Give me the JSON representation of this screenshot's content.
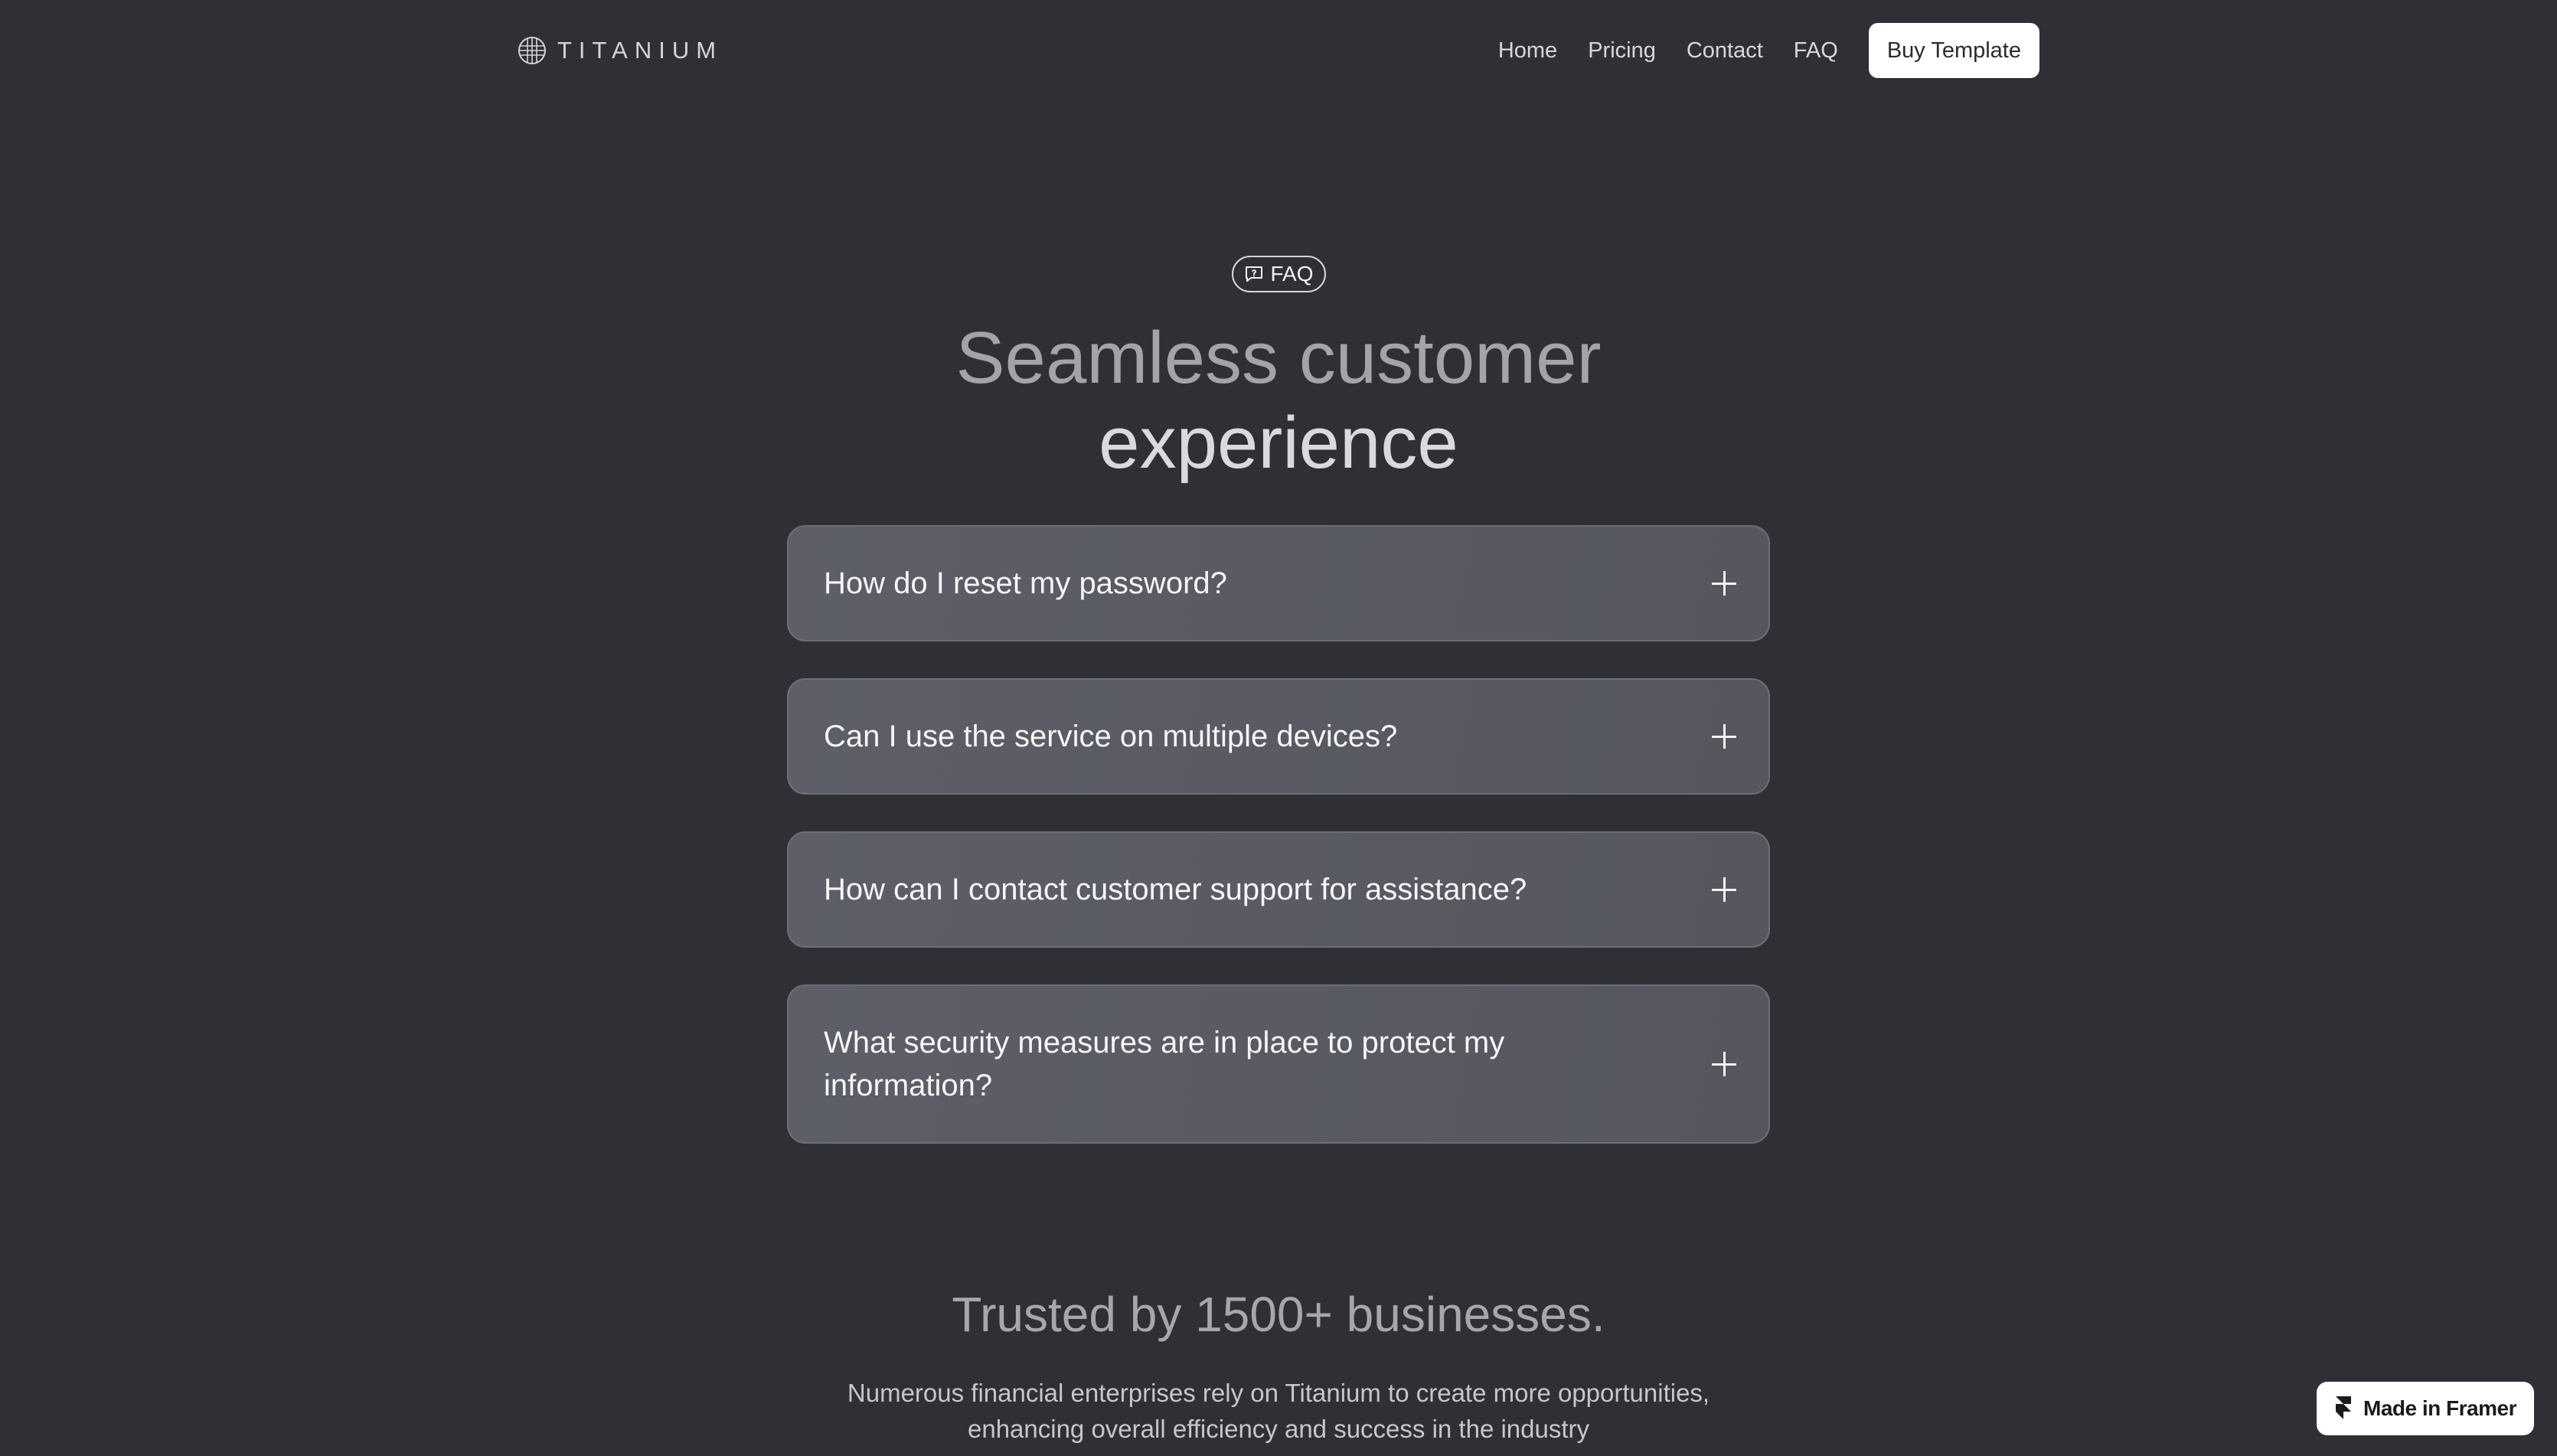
{
  "nav": {
    "logo_icon": "titanium-logo-icon",
    "logo_text": "TITANIUM",
    "links": [
      {
        "label": "Home"
      },
      {
        "label": "Pricing"
      },
      {
        "label": "Contact"
      },
      {
        "label": "FAQ"
      }
    ],
    "cta_label": "Buy Template"
  },
  "hero": {
    "badge_icon": "chat-bubble-question-icon",
    "badge_label": "FAQ",
    "title_line1": "Seamless customer",
    "title_line2": "experience"
  },
  "faq": {
    "expand_icon": "plus-icon",
    "items": [
      {
        "question": "How do I reset my password?"
      },
      {
        "question": "Can I use the service on multiple devices?"
      },
      {
        "question": "How can I contact customer support for assistance?"
      },
      {
        "question": "What security measures are in place to protect my information?"
      }
    ]
  },
  "trust": {
    "title": "Trusted by 1500+ businesses.",
    "subtitle": "Numerous financial enterprises rely on Titanium to create more opportunities, enhancing overall efficiency and success in the industry"
  },
  "framer_badge": {
    "icon": "framer-logo-icon",
    "label": "Made in Framer"
  },
  "colors": {
    "background": "#2f3035",
    "card": "#5d5e68",
    "cta_bg": "#ffffff"
  }
}
